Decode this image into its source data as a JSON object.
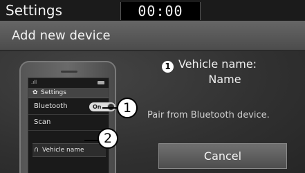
{
  "statusbar": {
    "title": "Settings",
    "clock": "00:00"
  },
  "header": {
    "title": "Add new device"
  },
  "phone": {
    "settings_label": "Settings",
    "bluetooth_label": "Bluetooth",
    "toggle_label": "On",
    "scan_label": "Scan",
    "vehicle_item_label": "Vehicle name"
  },
  "callouts": {
    "one": "1",
    "two": "2"
  },
  "info": {
    "badge": "1",
    "vehicle_name_label": "Vehicle name:",
    "vehicle_name_value": "Name",
    "pair_message": "Pair from Bluetooth device."
  },
  "buttons": {
    "cancel_label": "Cancel"
  },
  "colors": {
    "background": "#3a3a3a",
    "header": "#5a5a5a",
    "statusbar": "#1b1b1b"
  },
  "icons": [
    "gear-icon",
    "headphone-icon",
    "signal-icon",
    "battery-icon"
  ]
}
